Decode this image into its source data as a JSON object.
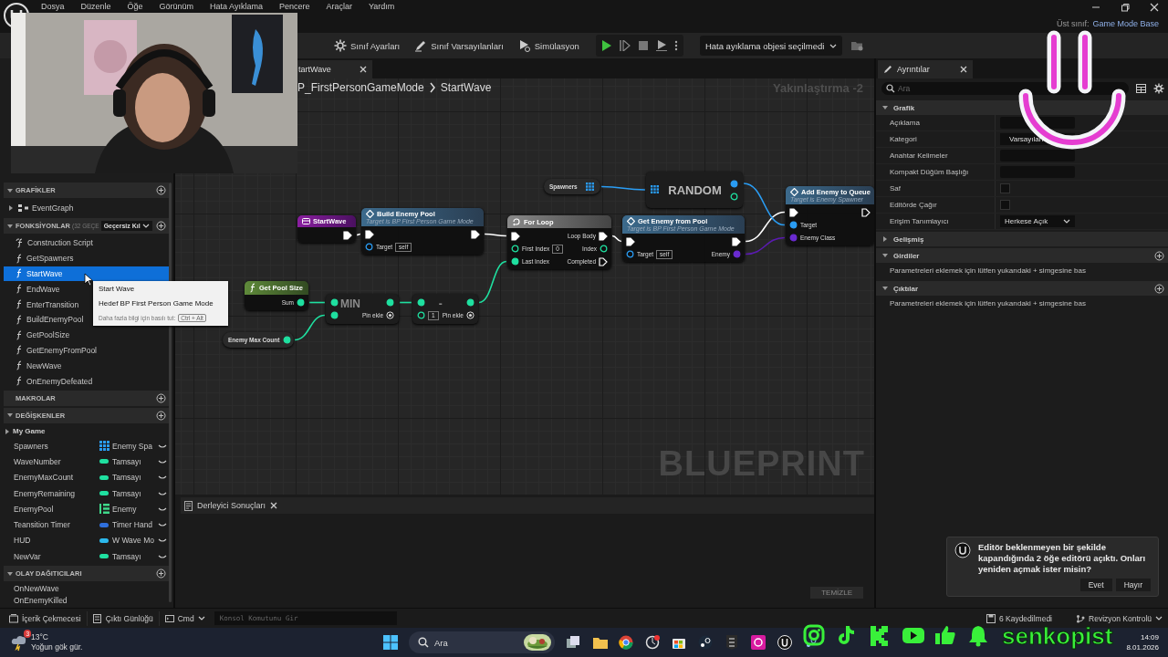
{
  "window": {
    "menu": [
      "Dosya",
      "Düzenle",
      "Öğe",
      "Görünüm",
      "Hata Ayıklama",
      "Pencere",
      "Araçlar",
      "Yardım"
    ],
    "parent_class_label": "Üst sınıf:",
    "parent_class": "Game Mode Base"
  },
  "toolbar": {
    "buttons": [
      {
        "kind": "settings",
        "label": "Sınıf Ayarları"
      },
      {
        "kind": "defaults",
        "label": "Sınıf Varsayılanları"
      },
      {
        "kind": "simulation",
        "label": "Simülasyon"
      }
    ],
    "debug_object": "Hata ayıklama objesi seçilmedi"
  },
  "my_blueprint": {
    "graphs": {
      "title": "GRAFİKLER",
      "expanded": true,
      "items": [
        {
          "label": "EventGraph",
          "expanded": false
        }
      ]
    },
    "functions": {
      "title": "FONKSİYONLAR",
      "count": "(32 GEÇE",
      "override": "Geçersiz Kıl",
      "expanded": true,
      "items": [
        {
          "kind": "construction",
          "label": "Construction Script",
          "selected": false
        },
        {
          "kind": "function",
          "label": "GetSpawners",
          "selected": false
        },
        {
          "kind": "function",
          "label": "StartWave",
          "selected": true
        },
        {
          "kind": "function",
          "label": "EndWave",
          "selected": false
        },
        {
          "kind": "function",
          "label": "EnterTransition",
          "selected": false
        },
        {
          "kind": "function",
          "label": "BuildEnemyPool",
          "selected": false
        },
        {
          "kind": "function",
          "label": "GetPoolSize",
          "selected": false
        },
        {
          "kind": "function",
          "label": "GetEnemyFromPool",
          "selected": false
        },
        {
          "kind": "function",
          "label": "NewWave",
          "selected": false
        },
        {
          "kind": "function",
          "label": "OnEnemyDefeated",
          "selected": false
        }
      ]
    },
    "macros": {
      "title": "MAKROLAR"
    },
    "variables": {
      "title": "DEĞİŞKENLER",
      "expanded": true,
      "category": "My Game",
      "items": [
        {
          "name": "Spawners",
          "type": "Enemy Spa",
          "kind": "array",
          "color": "#2a9df4"
        },
        {
          "name": "WaveNumber",
          "type": "Tamsayı",
          "kind": "single",
          "color": "#1fe0a0"
        },
        {
          "name": "EnemyMaxCount",
          "type": "Tamsayı",
          "kind": "single",
          "color": "#1fe0a0"
        },
        {
          "name": "EnemyRemaining",
          "type": "Tamsayı",
          "kind": "single",
          "color": "#1fe0a0"
        },
        {
          "name": "EnemyPool",
          "type": "Enemy",
          "kind": "list",
          "color": "#3fd98a"
        },
        {
          "name": "Teansition Timer",
          "type": "Timer Hand",
          "kind": "single",
          "color": "#2f6fdc"
        },
        {
          "name": "HUD",
          "type": "W Wave Mo",
          "kind": "single",
          "color": "#2cb8ec"
        },
        {
          "name": "NewVar",
          "type": "Tamsayı",
          "kind": "single",
          "color": "#1fe0a0"
        }
      ]
    },
    "dispatchers": {
      "title": "OLAY DAĞITICILARI",
      "expanded": true,
      "items": [
        "OnNewWave",
        "OnEnemyKilled"
      ]
    }
  },
  "tooltip": {
    "title": "Start Wave",
    "target": "Hedef BP First Person Game Mode",
    "hint": "Daha fazla bilgi için basılı tut:",
    "shortcut": "Ctrl + Alt"
  },
  "graph": {
    "tab": "tartWave",
    "breadcrumb": [
      "P_FirstPersonGameMode",
      "StartWave"
    ],
    "zoom": "Yakınlaştırma -2",
    "watermark": "BLUEPRINT",
    "nodes": [
      {
        "kind": "event",
        "title": "StartWave",
        "outputs": [
          {
            "kind": "exec",
            "connected": true
          }
        ]
      },
      {
        "kind": "function",
        "title": "Build Enemy Pool",
        "subtitle": "Target is BP First Person Game Mode",
        "inputs": [
          {
            "kind": "exec",
            "connected": true
          },
          {
            "kind": "object",
            "label": "Target",
            "value": "self",
            "connected": false
          }
        ],
        "outputs": [
          {
            "kind": "exec",
            "connected": true
          }
        ]
      },
      {
        "kind": "macro",
        "title": "For Loop",
        "inputs": [
          {
            "kind": "exec",
            "connected": true
          },
          {
            "kind": "int",
            "label": "First Index",
            "value": "0",
            "connected": false
          },
          {
            "kind": "int",
            "label": "Last Index",
            "connected": true
          }
        ],
        "outputs": [
          {
            "kind": "exec",
            "label": "Loop Body",
            "connected": true
          },
          {
            "kind": "int",
            "label": "Index",
            "connected": false
          },
          {
            "kind": "exec",
            "label": "Completed",
            "connected": false
          }
        ]
      },
      {
        "kind": "function",
        "title": "Get Enemy from Pool",
        "subtitle": "Target is BP First Person Game Mode",
        "inputs": [
          {
            "kind": "exec",
            "connected": true
          },
          {
            "kind": "object",
            "label": "Target",
            "value": "self",
            "connected": false
          }
        ],
        "outputs": [
          {
            "kind": "exec",
            "connected": true
          },
          {
            "kind": "class",
            "label": "Enemy",
            "connected": true
          }
        ]
      },
      {
        "kind": "variable",
        "title": "Spawners",
        "outputs": [
          {
            "kind": "array",
            "connected": true
          }
        ]
      },
      {
        "kind": "compact",
        "title": "RANDOM",
        "inputs": [
          {
            "kind": "array",
            "connected": true
          }
        ],
        "outputs": [
          {
            "kind": "object",
            "connected": true
          },
          {
            "kind": "int",
            "connected": false
          }
        ]
      },
      {
        "kind": "function",
        "title": "Add Enemy to Queue",
        "subtitle": "Target is Enemy Spawner",
        "inputs": [
          {
            "kind": "exec",
            "connected": true
          },
          {
            "kind": "object",
            "label": "Target",
            "connected": true
          },
          {
            "kind": "class",
            "label": "Enemy Class",
            "connected": true
          }
        ],
        "outputs": [
          {
            "kind": "exec",
            "connected": false
          }
        ]
      },
      {
        "kind": "pure",
        "title": "Get Pool Size",
        "outputs": [
          {
            "kind": "int",
            "label": "Sum",
            "connected": true
          }
        ]
      },
      {
        "kind": "compact",
        "title": "MIN",
        "inputs": [
          {
            "kind": "int",
            "connected": true
          },
          {
            "kind": "int",
            "connected": true
          }
        ],
        "outputs": [
          {
            "kind": "int",
            "connected": true
          },
          {
            "kind": "add",
            "label": "Pin ekle"
          }
        ]
      },
      {
        "kind": "compact",
        "title": "-",
        "inputs": [
          {
            "kind": "int",
            "connected": true
          },
          {
            "kind": "int",
            "value": "1",
            "connected": false
          }
        ],
        "outputs": [
          {
            "kind": "int",
            "connected": true
          },
          {
            "kind": "add",
            "label": "Pin ekle"
          }
        ]
      },
      {
        "kind": "variable",
        "title": "Enemy Max Count",
        "outputs": [
          {
            "kind": "int",
            "connected": true
          }
        ]
      }
    ]
  },
  "compiler": {
    "tab": "Derleyici Sonuçları",
    "clear": "TEMİZLE",
    "clear_disabled": true
  },
  "details": {
    "tab": "Ayrıntılar",
    "search_placeholder": "Ara",
    "sections": [
      {
        "title": "Grafik",
        "expanded": true,
        "rows": [
          {
            "kind": "text",
            "label": "Açıklama"
          },
          {
            "kind": "combo",
            "label": "Kategori",
            "value": "Varsayılan"
          },
          {
            "kind": "text",
            "label": "Anahtar Kelimeler"
          },
          {
            "kind": "text",
            "label": "Kompakt Düğüm Başlığı"
          },
          {
            "kind": "checkbox",
            "label": "Saf",
            "checked": false
          },
          {
            "kind": "checkbox",
            "label": "Editörde Çağır",
            "checked": false
          },
          {
            "kind": "dropdown",
            "label": "Erişim Tanımlayıcı",
            "value": "Herkese Açık"
          }
        ]
      },
      {
        "title": "Gelişmiş",
        "expanded": false
      },
      {
        "title": "Girdiler",
        "expanded": true,
        "addable": true,
        "message": "Parametreleri eklemek için lütfen yukarıdaki + simgesine bas"
      },
      {
        "title": "Çıktılar",
        "expanded": true,
        "addable": true,
        "message": "Parametreleri eklemek için lütfen yukarıdaki + simgesine bas"
      }
    ]
  },
  "status_bar": {
    "content_drawer": "İçerik Çekmecesi",
    "output_log": "Çıktı Günlüğü",
    "cmd": "Cmd",
    "console_placeholder": "Konsol Komutunu Gir",
    "unsaved": "6 Kaydedilmedi",
    "revision": "Revizyon Kontrolü"
  },
  "notification": {
    "message": "Editör beklenmeyen bir şekilde kapandığında 2 öğe editörü açıktı. Onları yeniden açmak ister misin?",
    "buttons": [
      "Evet",
      "Hayır"
    ]
  },
  "taskbar": {
    "temperature": "13°C",
    "weather": "Yoğun gök gür.",
    "weather_badge": "3",
    "search": "Ara",
    "time": "14:09",
    "date": "8.01.2026"
  },
  "overlay": {
    "handle": "senkopist"
  }
}
